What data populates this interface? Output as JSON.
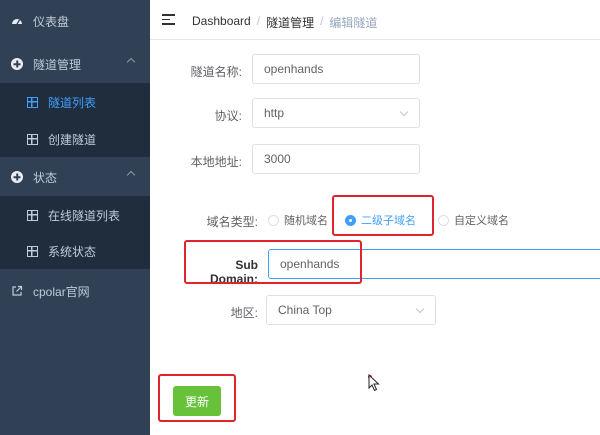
{
  "sidebar": {
    "items": [
      {
        "label": "仪表盘",
        "icon": "dashboard-icon"
      },
      {
        "label": "隧道管理",
        "icon": "plus-circle-icon"
      },
      {
        "label": "隧道列表",
        "icon": "grid-icon"
      },
      {
        "label": "创建隧道",
        "icon": "grid-icon"
      },
      {
        "label": "状态",
        "icon": "plus-circle-icon"
      },
      {
        "label": "在线隧道列表",
        "icon": "grid-icon"
      },
      {
        "label": "系统状态",
        "icon": "grid-icon"
      },
      {
        "label": "cpolar官网",
        "icon": "external-link-icon"
      }
    ]
  },
  "breadcrumb": {
    "home": "Dashboard",
    "parent": "隧道管理",
    "current": "编辑隧道",
    "separator": "/"
  },
  "form": {
    "tunnel_name_label": "隧道名称:",
    "tunnel_name_value": "openhands",
    "protocol_label": "协议:",
    "protocol_value": "http",
    "local_addr_label": "本地地址:",
    "local_addr_value": "3000",
    "domain_type_label": "域名类型:",
    "domain_options": [
      {
        "label": "随机域名",
        "checked": false
      },
      {
        "label": "二级子域名",
        "checked": true
      },
      {
        "label": "自定义域名",
        "checked": false
      }
    ],
    "subdomain_label": "Sub Domain:",
    "subdomain_value": "openhands",
    "region_label": "地区:",
    "region_value": "China Top",
    "update_button": "更新"
  },
  "colors": {
    "sidebar_bg": "#304156",
    "accent": "#409eff",
    "button_green": "#67c23a",
    "highlight_red": "#e0242b"
  }
}
